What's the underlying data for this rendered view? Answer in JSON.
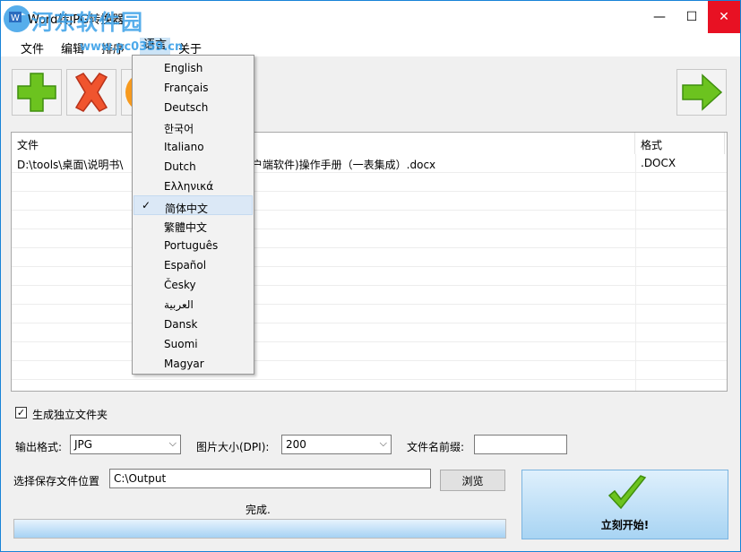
{
  "window": {
    "title": "Word转JPG转换器",
    "watermark": "河东软件园",
    "watermark_url": "www.pc0359.cn",
    "controls": {
      "minimize": "—",
      "maximize": "☐",
      "close": "✕"
    }
  },
  "menu": {
    "items": [
      "文件",
      "编辑",
      "排序",
      "语言",
      "关于"
    ]
  },
  "toolbar": {
    "buttons": [
      "add-icon",
      "delete-icon",
      "clear-icon",
      "next-arrow-icon"
    ]
  },
  "file_list": {
    "columns": [
      "文件",
      "格式"
    ],
    "rows": [
      {
        "file": "D:\\tools\\桌面\\说明书\\",
        "file_tail": "户端软件)操作手册（一表集成）.docx",
        "format": ".DOCX"
      }
    ]
  },
  "language_menu": {
    "items": [
      "English",
      "Français",
      "Deutsch",
      "한국어",
      "Italiano",
      "Dutch",
      "Ελληνικά",
      "简体中文",
      "繁體中文",
      "Português",
      "Español",
      "Česky",
      "العربية",
      "Dansk",
      "Suomi",
      "Magyar"
    ],
    "selected": "简体中文",
    "check": "✓"
  },
  "options": {
    "separate_folder_label": "生成独立文件夹",
    "separate_folder_checked": "✓",
    "output_format_label": "输出格式:",
    "output_format_value": "JPG",
    "dpi_label": "图片大小(DPI):",
    "dpi_value": "200",
    "prefix_label": "文件名前缀:",
    "prefix_value": "",
    "save_location_label": "选择保存文件位置",
    "save_location_value": "C:\\Output",
    "browse_label": "浏览",
    "start_label": "立刻开始!",
    "status_text": "完成."
  },
  "colors": {
    "accent": "#1883d7",
    "green": "#6cc31f",
    "red": "#f0542e",
    "orange": "#f79a1e"
  }
}
